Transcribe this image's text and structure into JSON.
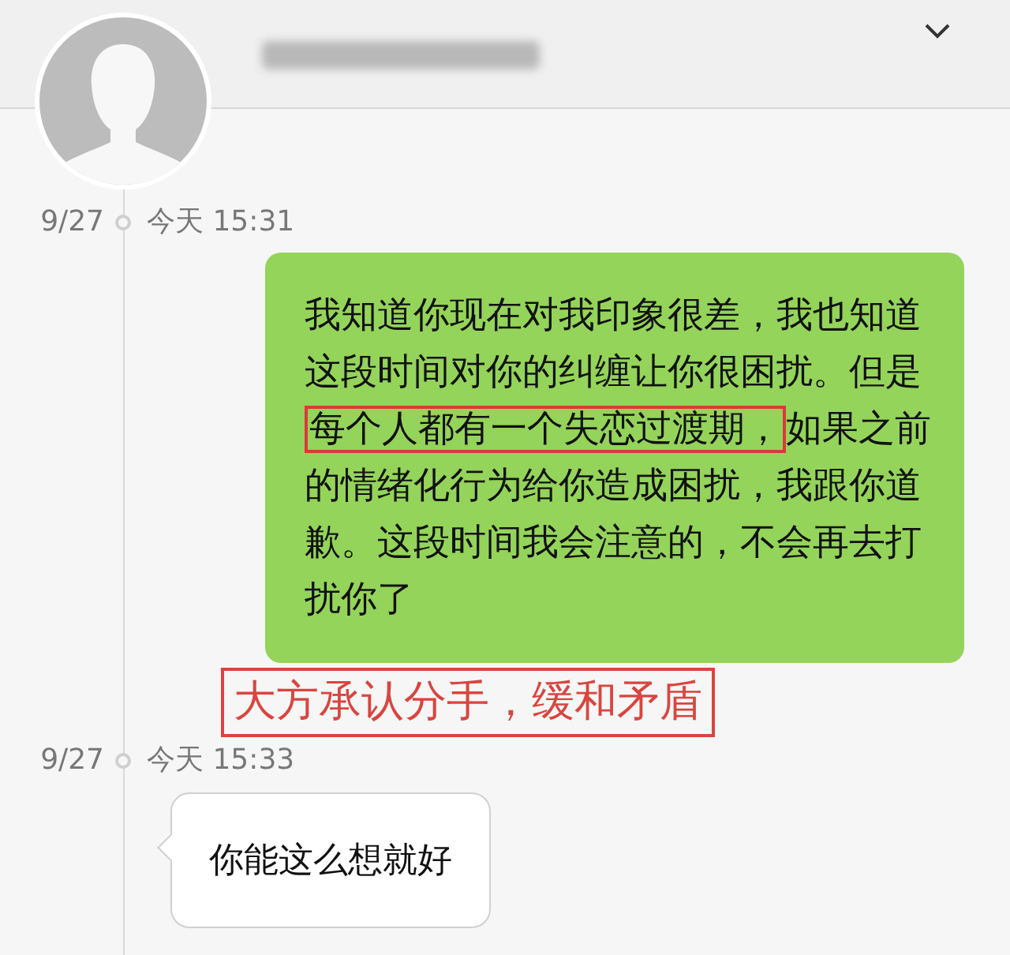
{
  "messages": [
    {
      "kind": "time",
      "date": "9/27",
      "time": "今天 15:31"
    },
    {
      "kind": "sent",
      "parts": [
        {
          "text": "我知道你现在对我印象很差，我也知道这段时间对你的纠缠让你很困扰。但是",
          "highlighted": false
        },
        {
          "text": "每个人都有一个失恋过渡期，",
          "highlighted": true
        },
        {
          "text": "如果之前的情绪化行为给你造成困扰，我跟你道歉。这段时间我会注意的，不会再去打扰你了",
          "highlighted": false
        }
      ]
    },
    {
      "kind": "annotation",
      "text": "大方承认分手，缓和矛盾"
    },
    {
      "kind": "time",
      "date": "9/27",
      "time": "今天 15:33"
    },
    {
      "kind": "received",
      "text": "你能这么想就好"
    }
  ]
}
